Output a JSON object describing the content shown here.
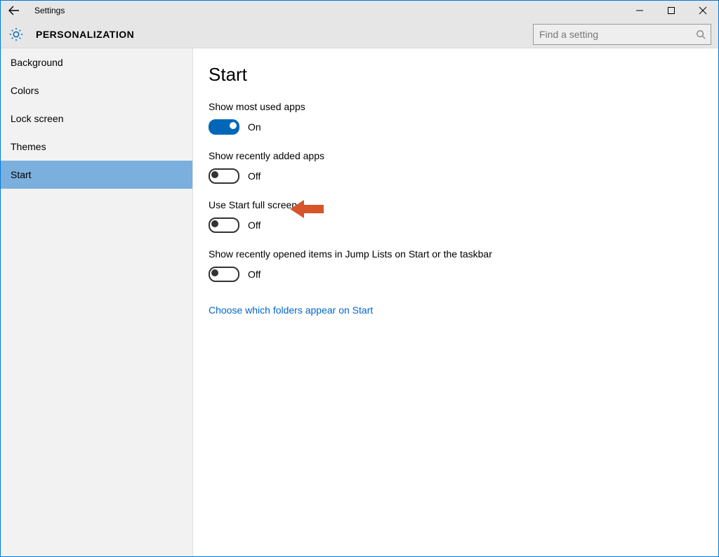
{
  "window": {
    "title": "Settings"
  },
  "header": {
    "section": "PERSONALIZATION",
    "search_placeholder": "Find a setting"
  },
  "sidebar": {
    "items": [
      {
        "label": "Background",
        "selected": false
      },
      {
        "label": "Colors",
        "selected": false
      },
      {
        "label": "Lock screen",
        "selected": false
      },
      {
        "label": "Themes",
        "selected": false
      },
      {
        "label": "Start",
        "selected": true
      }
    ]
  },
  "page": {
    "title": "Start",
    "options": [
      {
        "label": "Show most used apps",
        "state": "On",
        "on": true
      },
      {
        "label": "Show recently added apps",
        "state": "Off",
        "on": false
      },
      {
        "label": "Use Start full screen",
        "state": "Off",
        "on": false,
        "highlighted": true
      },
      {
        "label": "Show recently opened items in Jump Lists on Start or the taskbar",
        "state": "Off",
        "on": false
      }
    ],
    "link": "Choose which folders appear on Start"
  },
  "colors": {
    "accent": "#0067b8",
    "selection": "#7bafdd",
    "sidebar_bg": "#f2f2f2",
    "chrome_bg": "#e6e6e6",
    "link": "#0066cc",
    "arrow": "#d6552b"
  }
}
